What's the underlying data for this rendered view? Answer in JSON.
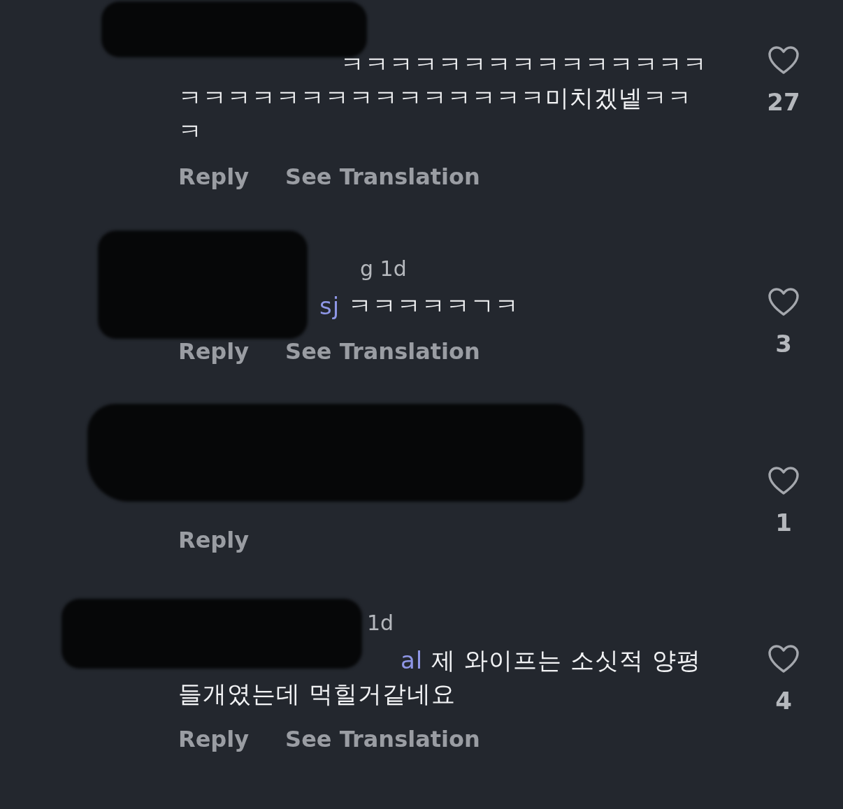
{
  "comments": [
    {
      "redacted": true,
      "text": " ㅋㅋㅋㅋㅋㅋㅋㅋㅋㅋㅋㅋㅋㅋㅋㅋㅋㅋㅋㅋㅋㅋㅋㅋㅋㅋㅋㅋㅋㅋ미치겠넽ㅋㅋㅋ",
      "actions": [
        "Reply",
        "See Translation"
      ],
      "liked": false,
      "likes": "27"
    },
    {
      "redacted": true,
      "header": "g 1d",
      "mention": "sj",
      "text": " ㅋㅋㅋㅋㅋㄱㅋ",
      "actions": [
        "Reply",
        "See Translation"
      ],
      "liked": false,
      "likes": "3"
    },
    {
      "redacted": true,
      "actions": [
        "Reply"
      ],
      "liked": false,
      "likes": "1"
    },
    {
      "redacted": true,
      "header": "1d",
      "mention": "al",
      "text": " 제 와이프는 소싯적 양평 들개였는데 먹힐거같네요",
      "actions": [
        "Reply",
        "See Translation"
      ],
      "liked": false,
      "likes": "4"
    }
  ]
}
